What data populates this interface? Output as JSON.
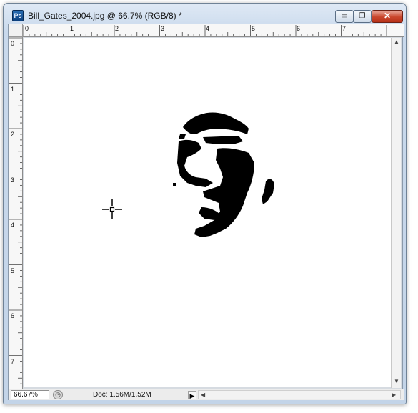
{
  "window": {
    "app_icon_label": "Ps",
    "title": "Bill_Gates_2004.jpg @ 66.7% (RGB/8) *",
    "min_glyph": "▭",
    "max_glyph": "❐",
    "close_glyph": "✕"
  },
  "rulers": {
    "horizontal_labels": [
      "0",
      "1",
      "2",
      "3",
      "4",
      "5",
      "6",
      "7"
    ],
    "vertical_labels": [
      "0",
      "1",
      "2",
      "3",
      "4",
      "5",
      "6",
      "7"
    ]
  },
  "status_bar": {
    "zoom": "66.67%",
    "doc_size": "Doc: 1.56M/1.52M",
    "menu_arrow": "▶"
  },
  "scroll": {
    "up": "▲",
    "down": "▼",
    "left": "◀",
    "right": "▶"
  },
  "icons": {
    "app": "photoshop-icon",
    "cursor": "crosshair-cursor-icon",
    "status": "timer-icon"
  }
}
